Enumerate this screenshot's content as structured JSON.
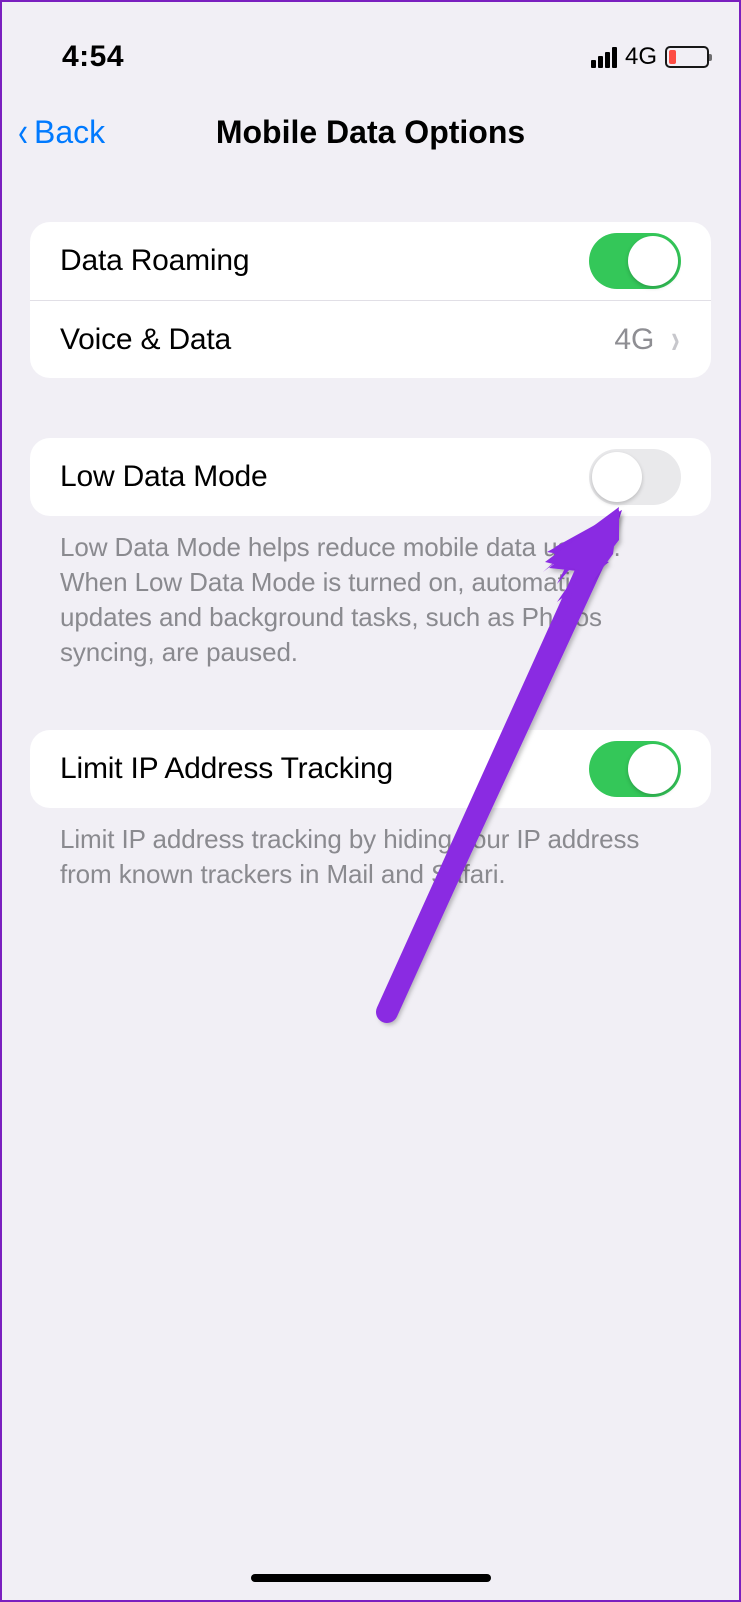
{
  "status": {
    "time": "4:54",
    "network": "4G"
  },
  "nav": {
    "back": "Back",
    "title": "Mobile Data Options"
  },
  "rows": {
    "data_roaming": {
      "label": "Data Roaming",
      "on": true
    },
    "voice_data": {
      "label": "Voice & Data",
      "value": "4G"
    },
    "low_data": {
      "label": "Low Data Mode",
      "on": false
    },
    "limit_ip": {
      "label": "Limit IP Address Tracking",
      "on": true
    }
  },
  "footers": {
    "low_data": "Low Data Mode helps reduce mobile data usage. When Low Data Mode is turned on, automatic updates and background tasks, such as Photos syncing, are paused.",
    "limit_ip": "Limit IP address tracking by hiding your IP address from known trackers in Mail and Safari."
  },
  "annotation": {
    "color": "#8a2be2"
  }
}
